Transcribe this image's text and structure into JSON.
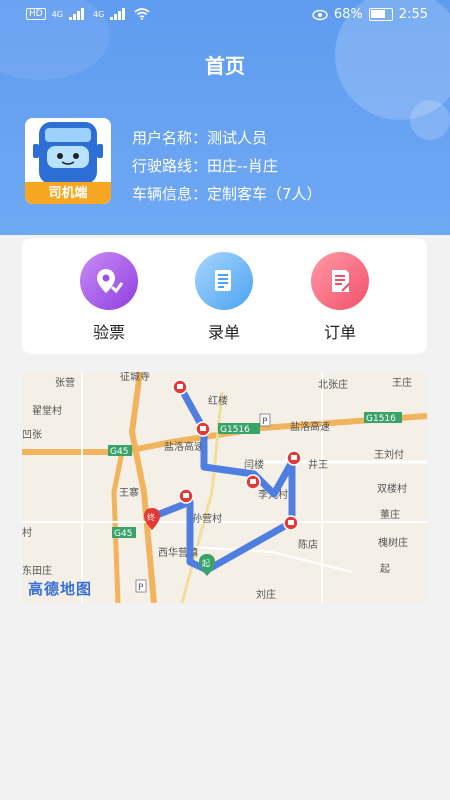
{
  "status_bar": {
    "hd_badge": "HD",
    "network_1": "4G",
    "network_2": "4G",
    "battery_percent": "68%",
    "time": "2:55"
  },
  "header": {
    "title": "首页",
    "avatar_caption": "司机端",
    "user_name": "用户名称：测试人员",
    "route": "行驶路线：田庄--肖庄",
    "vehicle": "车辆信息：定制客车（7人）"
  },
  "actions": [
    {
      "label": "验票",
      "icon": "location-check-icon",
      "color": "#a24fe4"
    },
    {
      "label": "录单",
      "icon": "document-list-icon",
      "color": "#4aa3f0"
    },
    {
      "label": "订单",
      "icon": "order-sheet-icon",
      "color": "#f2506a"
    }
  ],
  "map": {
    "watermark": "高德地图",
    "places": [
      "张营",
      "征城寺",
      "北张庄",
      "王庄",
      "翟堂村",
      "红楼",
      "G1516",
      "G1516",
      "盐洛高速",
      "盐洛高速",
      "凹张",
      "G45",
      "井王",
      "王刘付",
      "闫楼",
      "王寨",
      "李九村",
      "双楼村",
      "孙营村",
      "董庄",
      "村",
      "G45",
      "陈店",
      "槐树庄",
      "西华营镇",
      "起",
      "东田庄",
      "刘庄",
      "郭庄",
      "终"
    ],
    "route_color": "#4f7ee0"
  }
}
